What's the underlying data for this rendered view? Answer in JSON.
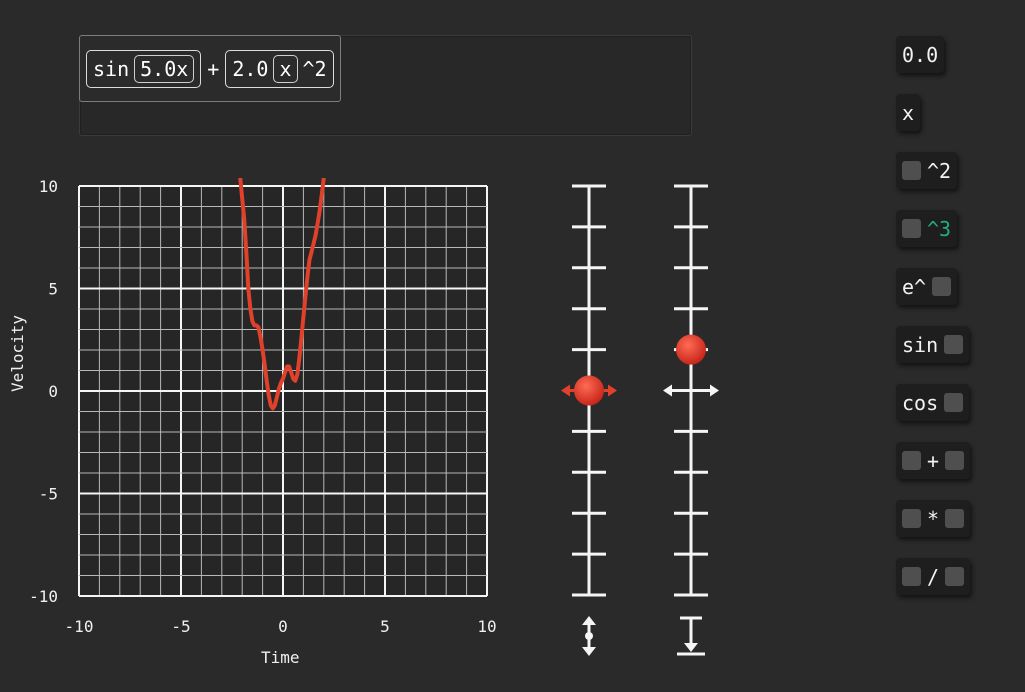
{
  "expression": {
    "sin_label": "sin",
    "sin_arg": "5.0x",
    "plus": "+",
    "coef": "2.0",
    "var": "x",
    "power": "^2"
  },
  "graph": {
    "xlabel": "Time",
    "ylabel": "Velocity",
    "x_ticks": [
      "-10",
      "-5",
      "0",
      "5",
      "10"
    ],
    "y_ticks": [
      "10",
      "5",
      "0",
      "-5",
      "-10"
    ]
  },
  "sliders": {
    "left_value": 0.0,
    "right_value": 2.0
  },
  "palette": [
    {
      "id": "zero",
      "label": "0.0"
    },
    {
      "id": "x",
      "label": "x"
    },
    {
      "id": "sq",
      "label": "^2"
    },
    {
      "id": "cube",
      "label": "^3"
    },
    {
      "id": "exp",
      "label": "e^"
    },
    {
      "id": "sin",
      "label": "sin"
    },
    {
      "id": "cos",
      "label": "cos"
    },
    {
      "id": "plus",
      "label": "+"
    },
    {
      "id": "mul",
      "label": "*"
    },
    {
      "id": "div",
      "label": "/"
    }
  ],
  "colors": {
    "background": "#2a2a2a",
    "curve": "#e0412b",
    "accent_green": "#21b07a",
    "slot": "#4f4f4f"
  },
  "chart_data": {
    "type": "line",
    "xlabel": "Time",
    "ylabel": "Velocity",
    "xlim": [
      -10,
      10
    ],
    "ylim": [
      -10,
      10
    ],
    "grid": true,
    "series": [
      {
        "x": [
          -2.1,
          -2.0,
          -1.9,
          -1.8,
          -1.7,
          -1.6,
          -1.5,
          -1.4,
          -1.3,
          -1.2,
          -1.1,
          -1.0,
          -0.9,
          -0.8,
          -0.7,
          -0.6,
          -0.5,
          -0.4,
          -0.3,
          -0.2,
          -0.1,
          0.0,
          0.1,
          0.2,
          0.3,
          0.4,
          0.5,
          0.6,
          0.7,
          0.8,
          0.9,
          1.0,
          1.1,
          1.2,
          1.3,
          1.4,
          1.5,
          1.6,
          1.7,
          1.8,
          1.9,
          2.0,
          2.1,
          2.2,
          2.3
        ],
        "y": [
          10.4,
          9.4,
          8.4,
          6.8,
          5.0,
          4.0,
          3.4,
          3.2,
          3.2,
          3.1,
          2.6,
          2.0,
          1.3,
          0.5,
          -0.2,
          -0.7,
          -0.85,
          -0.7,
          -0.3,
          0.1,
          0.4,
          0.6,
          0.9,
          1.2,
          1.2,
          0.9,
          0.6,
          0.5,
          0.8,
          1.6,
          2.6,
          3.6,
          4.6,
          5.6,
          6.4,
          6.8,
          7.2,
          7.6,
          8.2,
          8.8,
          9.6,
          10.4,
          10.8,
          11.0,
          11.2
        ]
      }
    ]
  }
}
